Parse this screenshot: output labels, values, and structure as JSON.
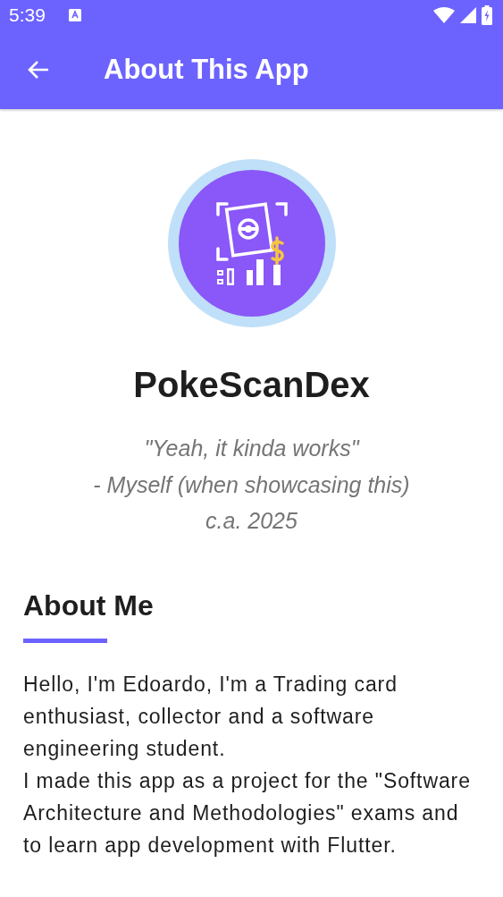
{
  "status_bar": {
    "time": "5:39"
  },
  "app_bar": {
    "title": "About This App"
  },
  "app_name": "PokeScanDex",
  "quote_lines": [
    "\"Yeah, it kinda works\"",
    "- Myself (when showcasing this)",
    "c.a. 2025"
  ],
  "section": {
    "heading": "About Me",
    "paragraphs": [
      "Hello, I'm Edoardo, I'm a Trading card enthusiast, collector and a software engineering student.",
      "I made this app as a project for the \"Software Architecture and Methodologies\" exams and to learn app development with Flutter."
    ]
  }
}
